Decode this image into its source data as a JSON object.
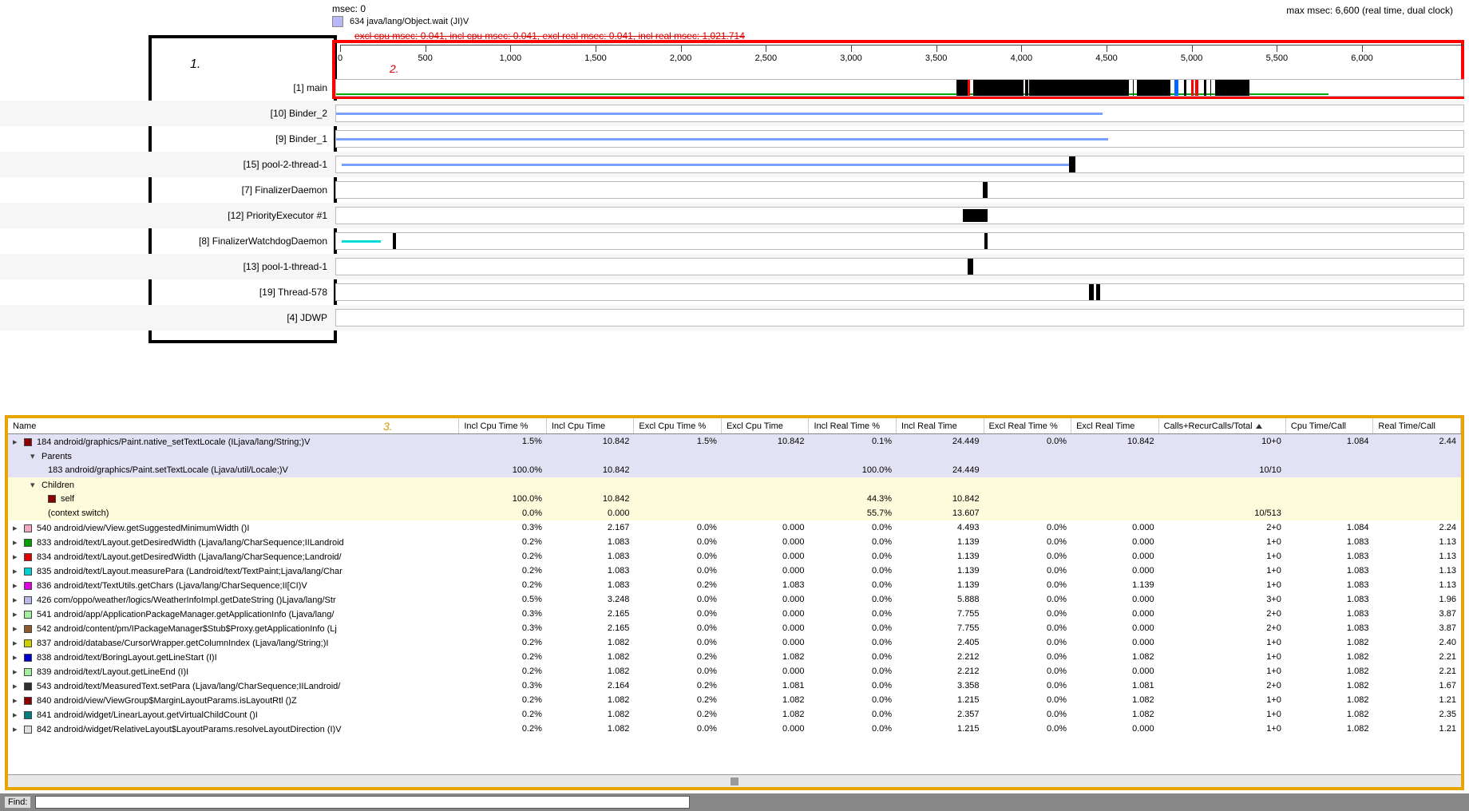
{
  "header": {
    "msec_label": "msec: 0",
    "max_msec": "max msec: 6,600 (real time, dual clock)",
    "selected_method": "634 java/lang/Object.wait (JI)V",
    "selected_stats": "excl cpu msec: 0.041, incl cpu msec: 0.041, excl real msec: 0.041, incl real msec: 1,021.714"
  },
  "annotations": {
    "one": "1.",
    "two": "2.",
    "three": "3."
  },
  "ruler": {
    "ticks": [
      "0",
      "500",
      "1,000",
      "1,500",
      "2,000",
      "2,500",
      "3,000",
      "3,500",
      "4,000",
      "4,500",
      "5,000",
      "5,500",
      "6,000"
    ],
    "max": 6600
  },
  "threads": [
    {
      "label": "[1] main"
    },
    {
      "label": "[10] Binder_2"
    },
    {
      "label": "[9] Binder_1"
    },
    {
      "label": "[15] pool-2-thread-1"
    },
    {
      "label": "[7] FinalizerDaemon"
    },
    {
      "label": "[12] PriorityExecutor #1"
    },
    {
      "label": "[8] FinalizerWatchdogDaemon"
    },
    {
      "label": "[13] pool-1-thread-1"
    },
    {
      "label": "[19] Thread-578"
    },
    {
      "label": "[4] JDWP"
    }
  ],
  "table": {
    "columns": [
      "Name",
      "Incl Cpu Time %",
      "Incl Cpu Time",
      "Excl Cpu Time %",
      "Excl Cpu Time",
      "Incl Real Time %",
      "Incl Real Time",
      "Excl Real Time %",
      "Excl Real Time",
      "Calls+RecurCalls/Total",
      "Cpu Time/Call",
      "Real Time/Call"
    ],
    "selected": {
      "color": "#8b0000",
      "name": "184 android/graphics/Paint.native_setTextLocale (ILjava/lang/String;)V",
      "cells": [
        "1.5%",
        "10.842",
        "1.5%",
        "10.842",
        "0.1%",
        "24.449",
        "0.0%",
        "10.842",
        "10+0",
        "1.084",
        "2.44"
      ]
    },
    "parents_label": "Parents",
    "parents": [
      {
        "color": "",
        "name": "183 android/graphics/Paint.setTextLocale (Ljava/util/Locale;)V",
        "cells": [
          "100.0%",
          "10.842",
          "",
          "",
          "100.0%",
          "24.449",
          "",
          "",
          "10/10",
          "",
          ""
        ]
      }
    ],
    "children_label": "Children",
    "children": [
      {
        "color": "#8b0000",
        "name": "self",
        "cells": [
          "100.0%",
          "10.842",
          "",
          "",
          "44.3%",
          "10.842",
          "",
          "",
          "",
          "",
          ""
        ]
      },
      {
        "color": "",
        "name": "(context switch)",
        "cells": [
          "0.0%",
          "0.000",
          "",
          "",
          "55.7%",
          "13.607",
          "",
          "",
          "10/513",
          "",
          ""
        ]
      }
    ],
    "rows": [
      {
        "color": "#f4a6c0",
        "name": "540 android/view/View.getSuggestedMinimumWidth ()I",
        "cells": [
          "0.3%",
          "2.167",
          "0.0%",
          "0.000",
          "0.0%",
          "4.493",
          "0.0%",
          "0.000",
          "2+0",
          "1.084",
          "2.24"
        ]
      },
      {
        "color": "#00a000",
        "name": "833 android/text/Layout.getDesiredWidth (Ljava/lang/CharSequence;IILandroid",
        "cells": [
          "0.2%",
          "1.083",
          "0.0%",
          "0.000",
          "0.0%",
          "1.139",
          "0.0%",
          "0.000",
          "1+0",
          "1.083",
          "1.13"
        ]
      },
      {
        "color": "#e00000",
        "name": "834 android/text/Layout.getDesiredWidth (Ljava/lang/CharSequence;Landroid/",
        "cells": [
          "0.2%",
          "1.083",
          "0.0%",
          "0.000",
          "0.0%",
          "1.139",
          "0.0%",
          "0.000",
          "1+0",
          "1.083",
          "1.13"
        ]
      },
      {
        "color": "#00d0d0",
        "name": "835 android/text/Layout.measurePara (Landroid/text/TextPaint;Ljava/lang/Char",
        "cells": [
          "0.2%",
          "1.083",
          "0.0%",
          "0.000",
          "0.0%",
          "1.139",
          "0.0%",
          "0.000",
          "1+0",
          "1.083",
          "1.13"
        ]
      },
      {
        "color": "#e000e0",
        "name": "836 android/text/TextUtils.getChars (Ljava/lang/CharSequence;II[CI)V",
        "cells": [
          "0.2%",
          "1.083",
          "0.2%",
          "1.083",
          "0.0%",
          "1.139",
          "0.0%",
          "1.139",
          "1+0",
          "1.083",
          "1.13"
        ]
      },
      {
        "color": "#b8b8e8",
        "name": "426 com/oppo/weather/logics/WeatherInfoImpl.getDateString ()Ljava/lang/Str",
        "cells": [
          "0.5%",
          "3.248",
          "0.0%",
          "0.000",
          "0.0%",
          "5.888",
          "0.0%",
          "0.000",
          "3+0",
          "1.083",
          "1.96"
        ]
      },
      {
        "color": "#a0f0a0",
        "name": "541 android/app/ApplicationPackageManager.getApplicationInfo (Ljava/lang/",
        "cells": [
          "0.3%",
          "2.165",
          "0.0%",
          "0.000",
          "0.0%",
          "7.755",
          "0.0%",
          "0.000",
          "2+0",
          "1.083",
          "3.87"
        ]
      },
      {
        "color": "#8b5a2b",
        "name": "542 android/content/pm/IPackageManager$Stub$Proxy.getApplicationInfo (Lj",
        "cells": [
          "0.3%",
          "2.165",
          "0.0%",
          "0.000",
          "0.0%",
          "7.755",
          "0.0%",
          "0.000",
          "2+0",
          "1.083",
          "3.87"
        ]
      },
      {
        "color": "#d0d000",
        "name": "837 android/database/CursorWrapper.getColumnIndex (Ljava/lang/String;)I",
        "cells": [
          "0.2%",
          "1.082",
          "0.0%",
          "0.000",
          "0.0%",
          "2.405",
          "0.0%",
          "0.000",
          "1+0",
          "1.082",
          "2.40"
        ]
      },
      {
        "color": "#0000d0",
        "name": "838 android/text/BoringLayout.getLineStart (I)I",
        "cells": [
          "0.2%",
          "1.082",
          "0.2%",
          "1.082",
          "0.0%",
          "2.212",
          "0.0%",
          "1.082",
          "1+0",
          "1.082",
          "2.21"
        ]
      },
      {
        "color": "#a0f0a0",
        "name": "839 android/text/Layout.getLineEnd (I)I",
        "cells": [
          "0.2%",
          "1.082",
          "0.0%",
          "0.000",
          "0.0%",
          "2.212",
          "0.0%",
          "0.000",
          "1+0",
          "1.082",
          "2.21"
        ]
      },
      {
        "color": "#303030",
        "name": "543 android/text/MeasuredText.setPara (Ljava/lang/CharSequence;IILandroid/",
        "cells": [
          "0.3%",
          "2.164",
          "0.2%",
          "1.081",
          "0.0%",
          "3.358",
          "0.0%",
          "1.081",
          "2+0",
          "1.082",
          "1.67"
        ]
      },
      {
        "color": "#8b0000",
        "name": "840 android/view/ViewGroup$MarginLayoutParams.isLayoutRtl ()Z",
        "cells": [
          "0.2%",
          "1.082",
          "0.2%",
          "1.082",
          "0.0%",
          "1.215",
          "0.0%",
          "1.082",
          "1+0",
          "1.082",
          "1.21"
        ]
      },
      {
        "color": "#008080",
        "name": "841 android/widget/LinearLayout.getVirtualChildCount ()I",
        "cells": [
          "0.2%",
          "1.082",
          "0.2%",
          "1.082",
          "0.0%",
          "2.357",
          "0.0%",
          "1.082",
          "1+0",
          "1.082",
          "2.35"
        ]
      },
      {
        "color": "#e0e0e0",
        "name": "842 android/widget/RelativeLayout$LayoutParams.resolveLayoutDirection (I)V",
        "cells": [
          "0.2%",
          "1.082",
          "0.0%",
          "0.000",
          "0.0%",
          "1.215",
          "0.0%",
          "0.000",
          "1+0",
          "1.082",
          "1.21"
        ]
      }
    ]
  },
  "find": {
    "label": "Find:",
    "value": ""
  }
}
